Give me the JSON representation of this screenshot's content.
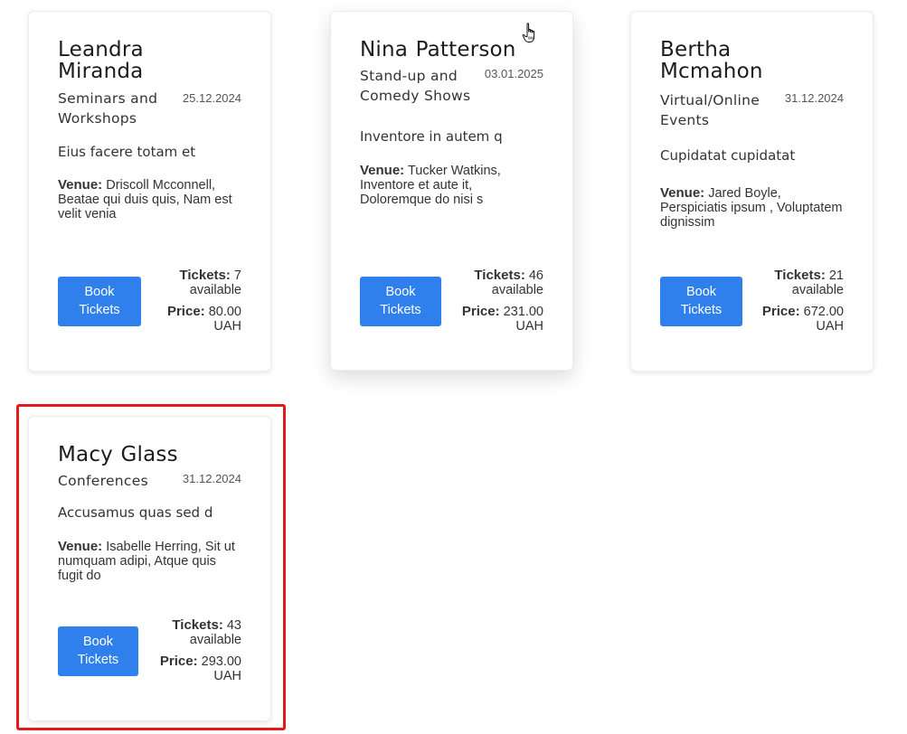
{
  "events": [
    {
      "name": "Leandra Miranda",
      "category": "Seminars and Workshops",
      "date": "25.12.2024",
      "description": "Eius facere totam et",
      "venue_label": "Venue:",
      "venue": "Driscoll Mcconnell, Beatae qui duis quis, Nam est velit venia",
      "book_label": "Book Tickets",
      "tickets_label": "Tickets:",
      "tickets": "7 available",
      "price_label": "Price:",
      "price": "80.00 UAH"
    },
    {
      "name": "Nina Patterson",
      "category": "Stand-up and Comedy Shows",
      "date": "03.01.2025",
      "description": "Inventore in autem q",
      "venue_label": "Venue:",
      "venue": "Tucker Watkins, Inventore et aute it, Doloremque do nisi s",
      "book_label": "Book Tickets",
      "tickets_label": "Tickets:",
      "tickets": "46 available",
      "price_label": "Price:",
      "price": "231.00 UAH"
    },
    {
      "name": "Bertha Mcmahon",
      "category": "Virtual/Online Events",
      "date": "31.12.2024",
      "description": "Cupidatat cupidatat",
      "venue_label": "Venue:",
      "venue": "Jared Boyle, Perspiciatis ipsum , Voluptatem dignissim",
      "book_label": "Book Tickets",
      "tickets_label": "Tickets:",
      "tickets": "21 available",
      "price_label": "Price:",
      "price": "672.00 UAH"
    },
    {
      "name": "Macy Glass",
      "category": "Conferences",
      "date": "31.12.2024",
      "description": "Accusamus quas sed d",
      "venue_label": "Venue:",
      "venue": "Isabelle Herring, Sit ut numquam adipi, Atque quis fugit do",
      "book_label": "Book Tickets",
      "tickets_label": "Tickets:",
      "tickets": "43 available",
      "price_label": "Price:",
      "price": "293.00 UAH"
    }
  ],
  "colors": {
    "button": "#2f80ed",
    "highlight": "#e01b1b"
  },
  "icons": {
    "cursor": "hand-pointer-icon"
  }
}
